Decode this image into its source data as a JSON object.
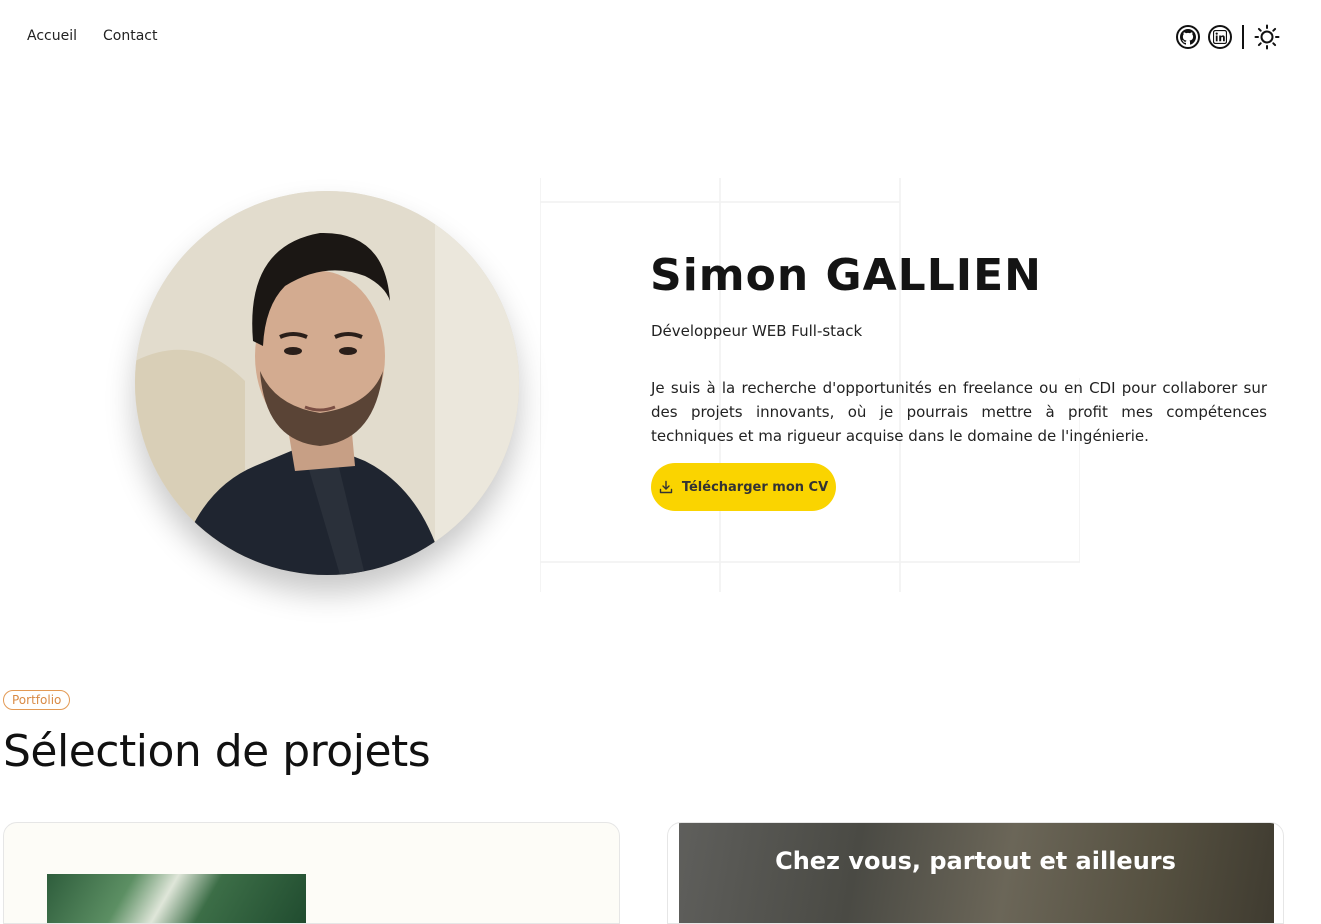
{
  "nav": {
    "links": [
      "Accueil",
      "Contact"
    ],
    "icons": [
      "github-icon",
      "linkedin-icon",
      "sun-icon"
    ]
  },
  "hero": {
    "name": "Simon GALLIEN",
    "subtitle": "Développeur WEB Full-stack",
    "bio": "Je suis à la recherche d'opportunités en freelance ou en CDI pour collaborer sur des projets innovants, où je pourrais mettre à profit mes compétences techniques et ma rigueur acquise dans le domaine de l'ingénierie.",
    "cv_button": "Télécharger mon CV"
  },
  "portfolio": {
    "badge": "Portfolio",
    "title": "Sélection de projets",
    "cards": [
      {
        "title": ""
      },
      {
        "title": "Chez vous, partout et ailleurs"
      }
    ]
  },
  "colors": {
    "accent": "#fad400",
    "badge": "#e39a55",
    "text": "#1a1a1a"
  }
}
